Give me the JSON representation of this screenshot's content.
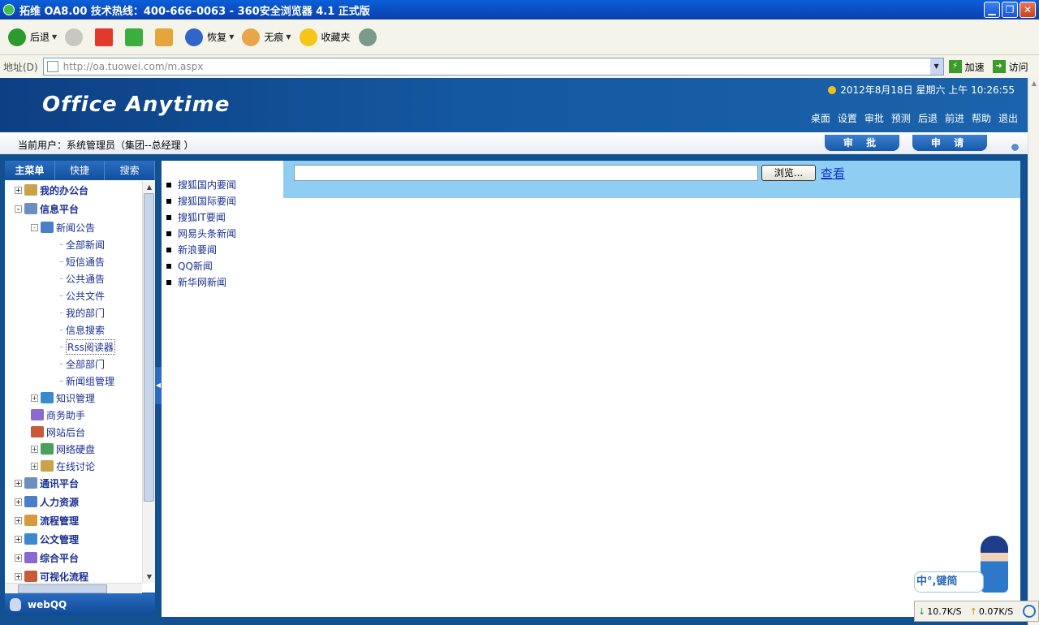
{
  "window": {
    "title": "拓维 OA8.00 技术热线：400-666-0063 - 360安全浏览器 4.1 正式版",
    "controls": [
      "minimize",
      "restore",
      "close"
    ]
  },
  "toolbar": {
    "back_label": "后退",
    "restore_label": "恢复",
    "incognito_label": "无痕",
    "favorites_label": "收藏夹"
  },
  "address": {
    "label": "地址(D)",
    "url": "http://oa.tuowei.com/m.aspx",
    "speedup_label": "加速",
    "go_label": "访问"
  },
  "header": {
    "logo": "Office Anytime",
    "datetime": "2012年8月18日 星期六 上午 10:26:55",
    "nav": [
      "桌面",
      "设置",
      "审批",
      "预测",
      "后退",
      "前进",
      "帮助",
      "退出"
    ]
  },
  "userbar": {
    "user_text": "当前用户：系统管理员（集团--总经理 ）",
    "approve_label": "审 批",
    "apply_label": "申 请"
  },
  "sidebar": {
    "tabs": [
      "主菜单",
      "快捷",
      "搜索"
    ],
    "tree": [
      {
        "label": "我的办公台",
        "level": 1,
        "expander": "+"
      },
      {
        "label": "信息平台",
        "level": 1,
        "expander": "-"
      },
      {
        "label": "新闻公告",
        "level": 2,
        "expander": "-"
      },
      {
        "label": "全部新闻",
        "level": 3
      },
      {
        "label": "短信通告",
        "level": 3
      },
      {
        "label": "公共通告",
        "level": 3
      },
      {
        "label": "公共文件",
        "level": 3
      },
      {
        "label": "我的部门",
        "level": 3
      },
      {
        "label": "信息搜索",
        "level": 3
      },
      {
        "label": "Rss阅读器",
        "level": 3,
        "selected": true
      },
      {
        "label": "全部部门",
        "level": 3
      },
      {
        "label": "新闻组管理",
        "level": 3
      },
      {
        "label": "知识管理",
        "level": 2,
        "expander": "+"
      },
      {
        "label": "商务助手",
        "level": 2
      },
      {
        "label": "网站后台",
        "level": 2
      },
      {
        "label": "网络硬盘",
        "level": 2,
        "expander": "+"
      },
      {
        "label": "在线讨论",
        "level": 2,
        "expander": "+"
      },
      {
        "label": "通讯平台",
        "level": 1,
        "expander": "+"
      },
      {
        "label": "人力资源",
        "level": 1,
        "expander": "+"
      },
      {
        "label": "流程管理",
        "level": 1,
        "expander": "+"
      },
      {
        "label": "公文管理",
        "level": 1,
        "expander": "+"
      },
      {
        "label": "综合平台",
        "level": 1,
        "expander": "+"
      },
      {
        "label": "可视化流程",
        "level": 1,
        "expander": "+"
      }
    ],
    "webqq_label": "webQQ"
  },
  "content": {
    "news_sources": [
      "搜狐国内要闻",
      "搜狐国际要闻",
      "搜狐IT要闻",
      "网易头条新闻",
      "新浪要闻",
      "QQ新闻",
      "新华网新闻"
    ],
    "rss_input_value": "",
    "browse_label": "浏览...",
    "view_label": "查看"
  },
  "ime": {
    "label": "中°,键简"
  },
  "status": {
    "download_speed": "10.7K/S",
    "upload_speed": "0.07K/S"
  },
  "colors": {
    "header_blue": "#14589f",
    "rss_bar": "#8fcdf3",
    "link_blue": "#1a2f90"
  }
}
